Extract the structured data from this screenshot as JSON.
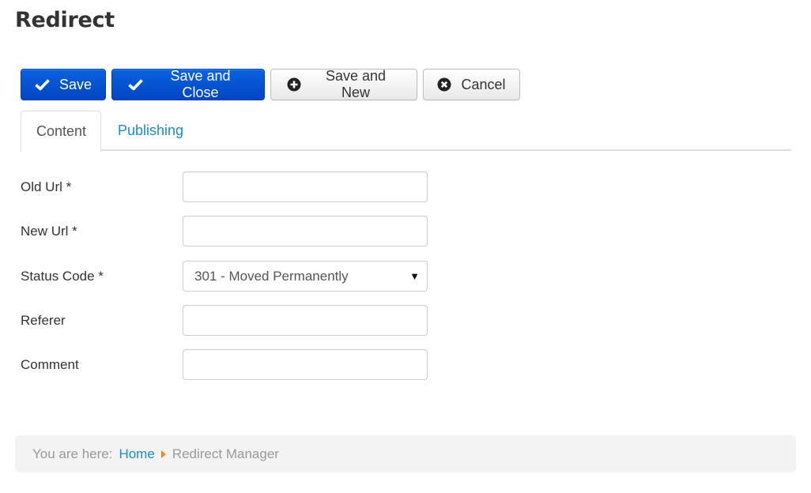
{
  "page": {
    "title": "Redirect"
  },
  "toolbar": {
    "save_label": "Save",
    "save_close_label": "Save and Close",
    "save_new_label": "Save and New",
    "cancel_label": "Cancel",
    "icons": {
      "save": "check-icon",
      "save_close": "check-icon",
      "save_new": "plus-circle-icon",
      "cancel": "times-circle-icon"
    },
    "colors": {
      "primary": "#0052d1",
      "default": "#f2f2f2"
    }
  },
  "tabs": [
    {
      "label": "Content",
      "active": true
    },
    {
      "label": "Publishing",
      "active": false
    }
  ],
  "form": {
    "fields": [
      {
        "label": "Old Url *",
        "value": "",
        "type": "text"
      },
      {
        "label": "New Url *",
        "value": "",
        "type": "text"
      },
      {
        "label": "Status Code *",
        "value": "301 - Moved Permanently",
        "type": "select"
      },
      {
        "label": "Referer",
        "value": "",
        "type": "text"
      },
      {
        "label": "Comment",
        "value": "",
        "type": "text"
      }
    ]
  },
  "breadcrumb": {
    "prefix": "You are here:",
    "items": [
      {
        "label": "Home",
        "link": true
      },
      {
        "label": "Redirect Manager",
        "link": false
      }
    ],
    "separator_color": "#f08a24",
    "link_color": "#1a8cc9"
  }
}
